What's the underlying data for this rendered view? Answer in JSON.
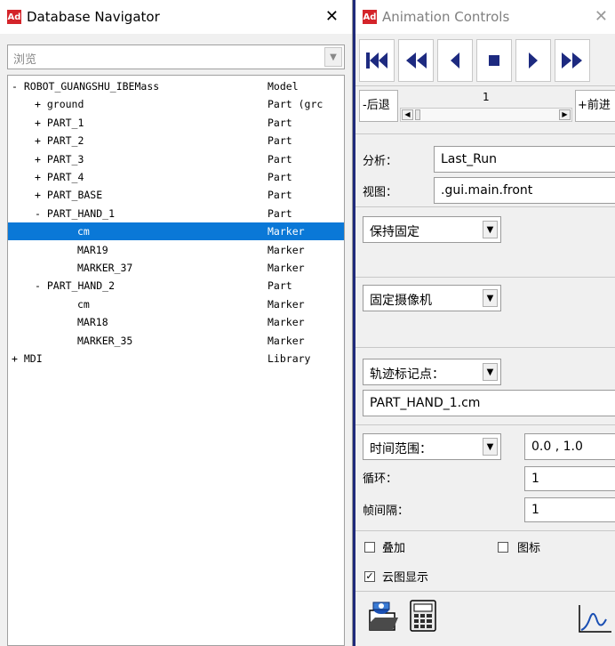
{
  "navigator": {
    "title": "Database Navigator",
    "browse_placeholder": "浏览",
    "rows": [
      {
        "name": "- ROBOT_GUANGSHU_IBEMass",
        "type": "Model",
        "indent": 0
      },
      {
        "name": "+ ground",
        "type": "Part (grc",
        "indent": 1
      },
      {
        "name": "+ PART_1",
        "type": "Part",
        "indent": 1
      },
      {
        "name": "+ PART_2",
        "type": "Part",
        "indent": 1
      },
      {
        "name": "+ PART_3",
        "type": "Part",
        "indent": 1
      },
      {
        "name": "+ PART_4",
        "type": "Part",
        "indent": 1
      },
      {
        "name": "+ PART_BASE",
        "type": "Part",
        "indent": 1
      },
      {
        "name": "- PART_HAND_1",
        "type": "Part",
        "indent": 1
      },
      {
        "name": "cm",
        "type": "Marker",
        "indent": 2,
        "selected": true
      },
      {
        "name": "MAR19",
        "type": "Marker",
        "indent": 2
      },
      {
        "name": "MARKER_37",
        "type": "Marker",
        "indent": 2
      },
      {
        "name": "- PART_HAND_2",
        "type": "Part",
        "indent": 1
      },
      {
        "name": "cm",
        "type": "Marker",
        "indent": 2
      },
      {
        "name": "MAR18",
        "type": "Marker",
        "indent": 2
      },
      {
        "name": "MARKER_35",
        "type": "Marker",
        "indent": 2
      },
      {
        "name": "+ MDI",
        "type": "Library",
        "indent": 0
      }
    ]
  },
  "animation": {
    "title": "Animation Controls",
    "step_back": "-后退",
    "step_forward": "+前进",
    "frame": "1",
    "analysis_label": "分析：",
    "analysis_value": "Last_Run",
    "view_label": "视图：",
    "view_value": ".gui.main.front",
    "hold_fixed": "保持固定",
    "fixed_camera": "固定摄像机",
    "trace_marker": "轨迹标记点：",
    "trace_value": "PART_HAND_1.cm",
    "time_range": "时间范围：",
    "time_range_value": "0.0 , 1.0",
    "loop_label": "循环：",
    "loop_value": "1",
    "frame_interval_label": "帧间隔：",
    "frame_interval_value": "1",
    "superimpose": "叠加",
    "icons_label": "图标",
    "contour_display": "云图显示",
    "contour_checked": "✓"
  }
}
